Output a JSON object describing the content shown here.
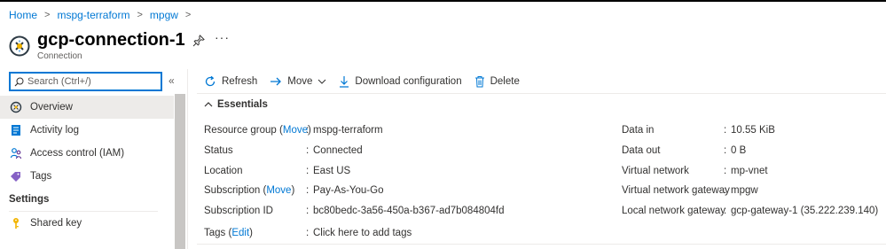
{
  "breadcrumb": {
    "items": [
      "Home",
      "mspg-terraform",
      "mpgw"
    ],
    "separator": ">"
  },
  "resource": {
    "title": "gcp-connection-1",
    "type": "Connection",
    "icon": "connection-icon",
    "more": "···"
  },
  "sidebar": {
    "search_placeholder": "Search (Ctrl+/)",
    "collapse": "«",
    "items": [
      {
        "label": "Overview",
        "icon": "overview-icon",
        "active": true
      },
      {
        "label": "Activity log",
        "icon": "activity-log-icon"
      },
      {
        "label": "Access control (IAM)",
        "icon": "iam-icon"
      },
      {
        "label": "Tags",
        "icon": "tag-icon"
      }
    ],
    "section": "Settings",
    "settings_items": [
      {
        "label": "Shared key",
        "icon": "key-icon"
      }
    ]
  },
  "toolbar": {
    "refresh": "Refresh",
    "move": "Move",
    "download": "Download configuration",
    "delete": "Delete"
  },
  "essentials": {
    "heading": "Essentials",
    "left": {
      "resource_group_label": "Resource group",
      "resource_group_link": "Move",
      "resource_group_value": "mspg-terraform",
      "status_label": "Status",
      "status_value": "Connected",
      "location_label": "Location",
      "location_value": "East US",
      "subscription_label": "Subscription",
      "subscription_link": "Move",
      "subscription_value": "Pay-As-You-Go",
      "subscription_id_label": "Subscription ID",
      "subscription_id_value": "bc80bedc-3a56-450a-b367-ad7b084804fd"
    },
    "right": {
      "data_in_label": "Data in",
      "data_in_value": "10.55 KiB",
      "data_out_label": "Data out",
      "data_out_value": "0 B",
      "vnet_label": "Virtual network",
      "vnet_value": "mp-vnet",
      "vnet_gateway_label": "Virtual network gateway",
      "vnet_gateway_value": "mpgw",
      "local_gateway_label": "Local network gateway",
      "local_gateway_value": "gcp-gateway-1 (35.222.239.140)"
    },
    "tags": {
      "label": "Tags",
      "edit": "Edit",
      "value": "Click here to add tags"
    }
  },
  "colors": {
    "accent": "#0078d4",
    "active_bg": "#edebe9",
    "text": "#323130"
  }
}
